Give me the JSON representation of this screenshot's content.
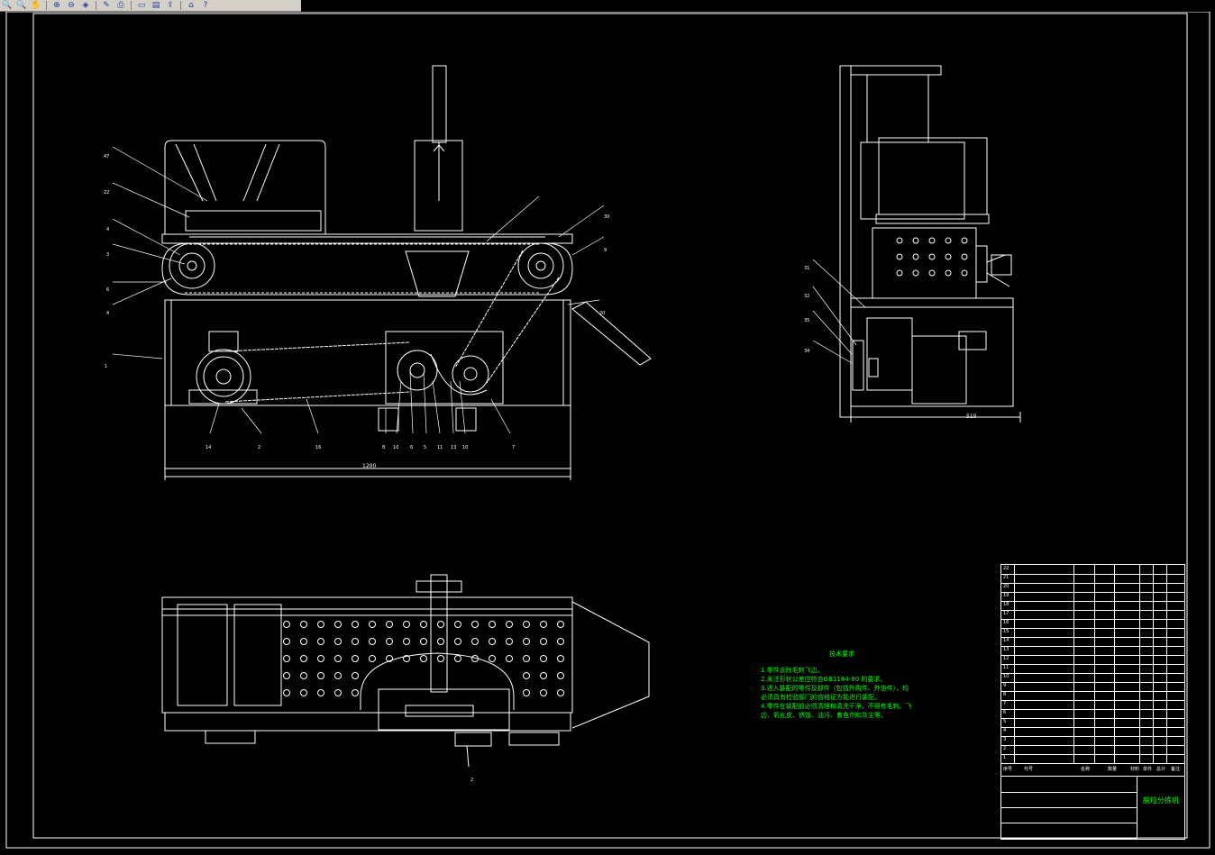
{
  "toolbar": {
    "buttons": [
      {
        "name": "zoom-window-icon",
        "glyph": "🔍"
      },
      {
        "name": "zoom-in-icon",
        "glyph": "🔍"
      },
      {
        "name": "pan-icon",
        "glyph": "✋"
      },
      {
        "name": "zoom-plus-icon",
        "glyph": "⊕"
      },
      {
        "name": "zoom-minus-icon",
        "glyph": "⊖"
      },
      {
        "name": "layers-icon",
        "glyph": "◈"
      },
      {
        "name": "measure-icon",
        "glyph": "✎"
      },
      {
        "name": "print-icon",
        "glyph": "⎙"
      },
      {
        "name": "save-icon",
        "glyph": "▭"
      },
      {
        "name": "ctrl-icon",
        "glyph": "▤"
      },
      {
        "name": "export-icon",
        "glyph": "⇪"
      },
      {
        "name": "home-icon",
        "glyph": "⌂"
      },
      {
        "name": "help-icon",
        "glyph": "?"
      }
    ]
  },
  "colors": {
    "line": "#ffffff",
    "note": "#00ff00",
    "bg": "#000000"
  },
  "front_view": {
    "labels": [
      "47",
      "22",
      "4",
      "3",
      "6",
      "4",
      "1",
      "14",
      "2",
      "16",
      "8",
      "10",
      "6",
      "5",
      "11",
      "13",
      "10",
      "7",
      "30",
      "9",
      "20"
    ],
    "dimension": "1200"
  },
  "side_view": {
    "labels": [
      "31",
      "32",
      "35",
      "34"
    ],
    "dimension": "510"
  },
  "top_view": {
    "labels": [
      "2"
    ]
  },
  "tech_notes": {
    "title": "技术要求",
    "lines": [
      "1.零件去除毛刺飞边。",
      "2.未注形状公差应符合GB1184-80 的要求。",
      "3.进入装配的零件及部件（包括外购件、外协件），均",
      "必须具有检验部门的合格证方能进行装配。",
      "4.零件在装配前必须清理和清洗干净，不得有毛刺、飞",
      "边、氧化皮、锈蚀、油污、着色剂和灰尘等。"
    ]
  },
  "title_block": {
    "header": [
      "序号",
      "代号",
      "名称",
      "数量",
      "材料",
      "单件",
      "总计",
      "备注"
    ],
    "drawing_title": "脱粒分拣机",
    "rows": [
      "22",
      "21",
      "20",
      "19",
      "18",
      "17",
      "16",
      "15",
      "14",
      "13",
      "12",
      "11",
      "10",
      "9",
      "8",
      "7",
      "6",
      "5",
      "4",
      "3",
      "2",
      "1"
    ]
  }
}
